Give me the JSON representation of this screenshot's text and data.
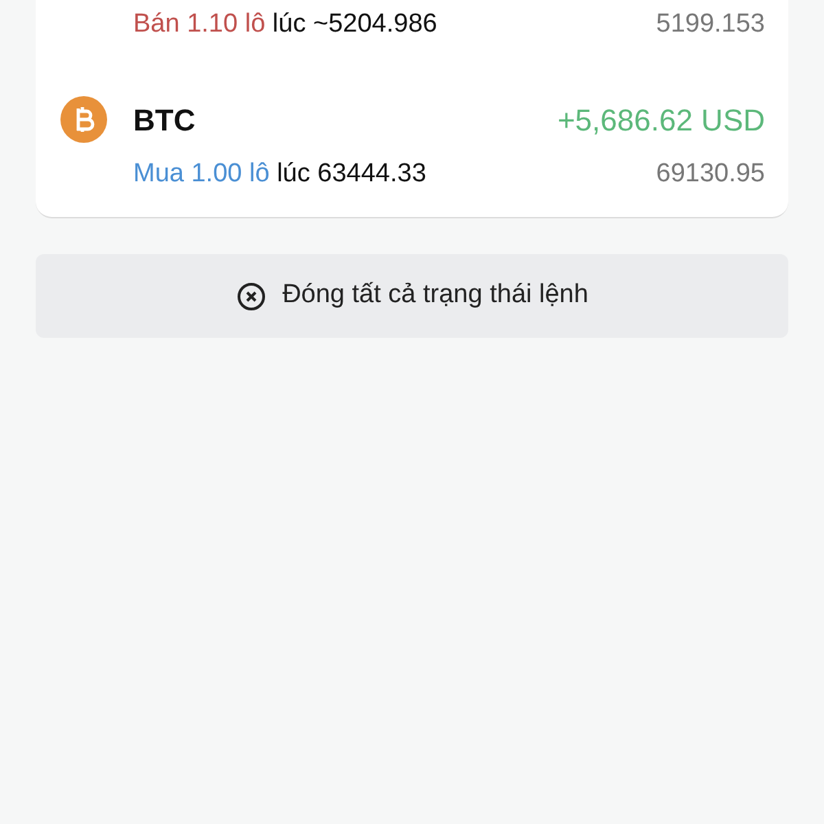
{
  "positions": [
    {
      "kind": "sell",
      "order": "Bán 1.10 lô",
      "opened": "lúc ~5204.986",
      "current": "5199.153"
    },
    {
      "symbol": "BTC",
      "profit": "+5,686.62 USD",
      "kind": "buy",
      "order": "Mua 1.00 lô",
      "opened": "lúc 63444.33",
      "current": "69130.95"
    }
  ],
  "close_all_button": {
    "label": "Đóng tất cả trạng thái lệnh"
  }
}
